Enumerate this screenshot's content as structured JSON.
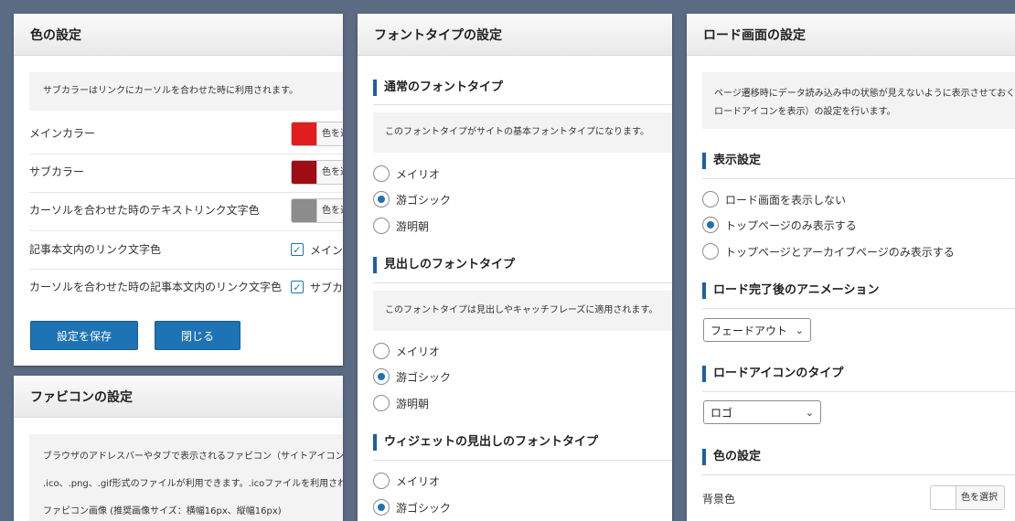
{
  "color_panel": {
    "title": "色の設定",
    "note": "サブカラーはリンクにカーソルを合わせた時に利用されます。",
    "rows": [
      {
        "label": "メインカラー",
        "swatch_color": "#e01e1e",
        "button": "色を選"
      },
      {
        "label": "サブカラー",
        "swatch_color": "#9e0d12",
        "button": "色を選"
      },
      {
        "label": "カーソルを合わせた時のテキストリンク文字色",
        "swatch_color": "#8c8c8c",
        "button": "色を選"
      }
    ],
    "checks": [
      {
        "label": "記事本文内のリンク文字色",
        "checked": true,
        "option": "メイン"
      },
      {
        "label": "カーソルを合わせた時の記事本文内のリンク文字色",
        "checked": true,
        "option": "サブカ"
      }
    ],
    "save_button": "設定を保存",
    "close_button": "閉じる"
  },
  "favicon_panel": {
    "title": "ファビコンの設定",
    "line1": "ブラウザのアドレスバーやタブで表示されるファビコン（サイトアイコン）",
    "line2": ".ico、.png、.gif形式のファイルが利用できます。.icoファイルを利用される",
    "line3": "ファビコン画像 (推奨画像サイズ：横幅16px、縦幅16px)"
  },
  "font_panel": {
    "title": "フォントタイプの設定",
    "sections": [
      {
        "title": "通常のフォントタイプ",
        "note": "このフォントタイプがサイトの基本フォントタイプになります。",
        "options": [
          "メイリオ",
          "游ゴシック",
          "游明朝"
        ],
        "selected": 1
      },
      {
        "title": "見出しのフォントタイプ",
        "note": "このフォントタイプは見出しやキャッチフレーズに適用されます。",
        "options": [
          "メイリオ",
          "游ゴシック",
          "游明朝"
        ],
        "selected": 1
      },
      {
        "title": "ウィジェットの見出しのフォントタイプ",
        "options": [
          "メイリオ",
          "游ゴシック"
        ],
        "selected": 1
      }
    ]
  },
  "load_panel": {
    "title": "ロード画面の設定",
    "note_line1": "ページ遷移時にデータ読み込み中の状態が見えないように表示させておく",
    "note_line2": "ロードアイコンを表示）の設定を行います。",
    "display_title": "表示設定",
    "display_options": [
      "ロード画面を表示しない",
      "トップページのみ表示する",
      "トップページとアーカイブページのみ表示する"
    ],
    "display_selected": 1,
    "animation_title": "ロード完了後のアニメーション",
    "animation_value": "フェードアウト",
    "icon_title": "ロードアイコンのタイプ",
    "icon_value": "ロゴ",
    "color_title": "色の設定",
    "bg_label": "背景色",
    "bg_button": "色を選択",
    "bg_color": "#ffffff"
  },
  "colors": {
    "accent": "#1d73b3",
    "section_bar": "#1d5fa8",
    "page_bg": "#5b6b83"
  }
}
